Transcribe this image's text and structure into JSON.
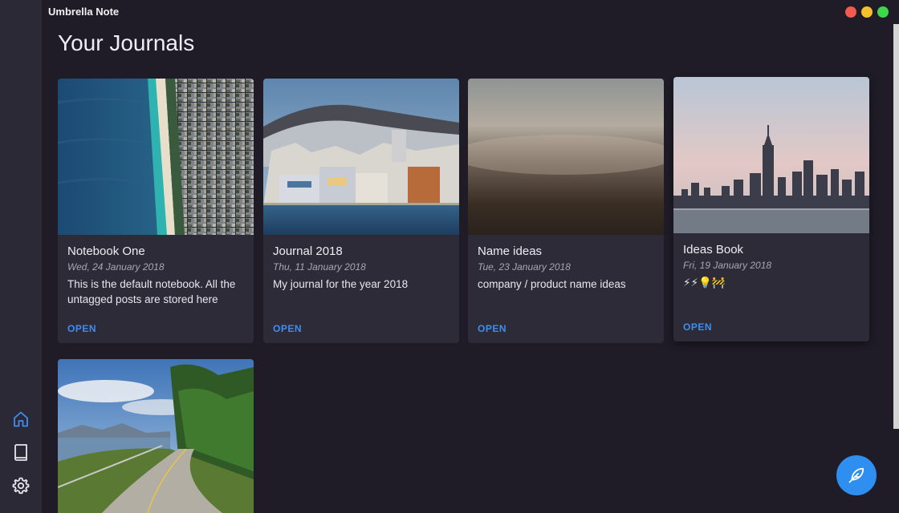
{
  "app": {
    "title": "Umbrella Note"
  },
  "window_controls": {
    "close_color": "#f05a4f",
    "minimize_color": "#f5c12b",
    "maximize_color": "#3ed64a"
  },
  "page": {
    "title": "Your Journals"
  },
  "sidebar": {
    "items": [
      {
        "icon": "home-icon",
        "active": true
      },
      {
        "icon": "book-icon",
        "active": false
      },
      {
        "icon": "gear-icon",
        "active": false
      }
    ]
  },
  "journals": [
    {
      "title": "Notebook One",
      "date": "Wed, 24 January 2018",
      "description": "This is the default notebook. All the untagged posts are stored here",
      "action": "OPEN",
      "image": "aerial-beach-photo"
    },
    {
      "title": "Journal 2018",
      "date": "Thu, 11 January 2018",
      "description": "My journal for the year 2018",
      "action": "OPEN",
      "image": "harbor-town-photo"
    },
    {
      "title": "Name ideas",
      "date": "Tue, 23 January 2018",
      "description": "company / product name ideas",
      "action": "OPEN",
      "image": "blurred-horizon-photo"
    },
    {
      "title": "Ideas Book",
      "date": "Fri, 19 January 2018",
      "description": "⚡⚡💡🚧",
      "action": "OPEN",
      "image": "city-skyline-photo"
    },
    {
      "title": "",
      "date": "",
      "description": "",
      "action": "",
      "image": "mountain-road-photo"
    }
  ],
  "fab": {
    "icon": "feather-icon"
  },
  "colors": {
    "accent": "#2f8ff0",
    "background": "#1f1c27",
    "card": "#2e2b38",
    "sidebar": "#2b2935"
  }
}
